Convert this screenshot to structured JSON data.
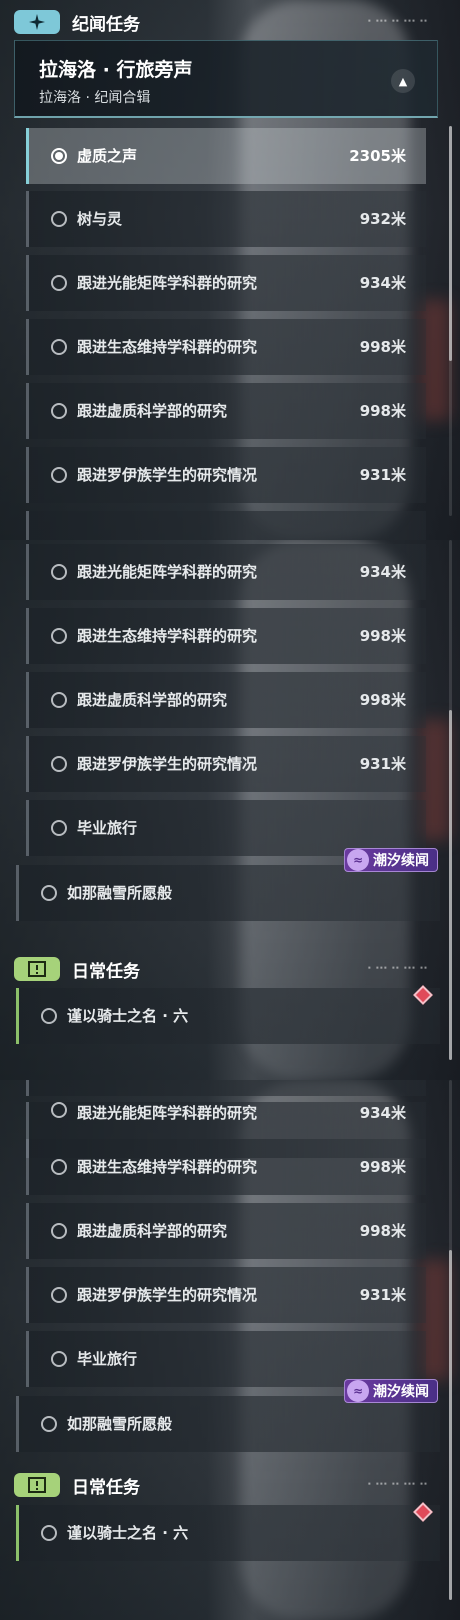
{
  "screens": [
    {
      "header": {
        "title": "纪闻任务",
        "icon": "sparkle-icon",
        "color": "#7ec8d8"
      },
      "selected_quest": {
        "title": "拉海洛 · 行旅旁声",
        "subtitle": "拉海洛 · 纪闻合辑"
      },
      "items": [
        {
          "name": "虚质之声",
          "dist": "2305米",
          "active": true
        },
        {
          "name": "树与灵",
          "dist": "932米"
        },
        {
          "name": "跟进光能矩阵学科群的研究",
          "dist": "934米"
        },
        {
          "name": "跟进生态维持学科群的研究",
          "dist": "998米"
        },
        {
          "name": "跟进虚质科学部的研究",
          "dist": "998米"
        },
        {
          "name": "跟进罗伊族学生的研究情况",
          "dist": "931米"
        }
      ]
    },
    {
      "items": [
        {
          "name": "跟进光能矩阵学科群的研究",
          "dist": "934米"
        },
        {
          "name": "跟进生态维持学科群的研究",
          "dist": "998米"
        },
        {
          "name": "跟进虚质科学部的研究",
          "dist": "998米"
        },
        {
          "name": "跟进罗伊族学生的研究情况",
          "dist": "931米"
        },
        {
          "name": "毕业旅行",
          "dist": ""
        }
      ],
      "standalone": {
        "name": "如那融雪所愿般",
        "tag": "潮汐续闻"
      },
      "daily_header": {
        "title": "日常任务",
        "icon": "exclamation-icon",
        "color": "#a6d27a"
      },
      "daily_item": {
        "name": "谨以骑士之名 · 六"
      }
    },
    {
      "items": [
        {
          "name": "跟进光能矩阵学科群的研究",
          "dist": "934米"
        },
        {
          "name": "跟进生态维持学科群的研究",
          "dist": "998米"
        },
        {
          "name": "跟进虚质科学部的研究",
          "dist": "998米"
        },
        {
          "name": "跟进罗伊族学生的研究情况",
          "dist": "931米"
        },
        {
          "name": "毕业旅行",
          "dist": ""
        }
      ],
      "standalone": {
        "name": "如那融雪所愿般",
        "tag": "潮汐续闻"
      },
      "daily_header": {
        "title": "日常任务",
        "icon": "exclamation-icon",
        "color": "#a6d27a"
      },
      "daily_item": {
        "name": "谨以骑士之名 · 六"
      }
    }
  ]
}
